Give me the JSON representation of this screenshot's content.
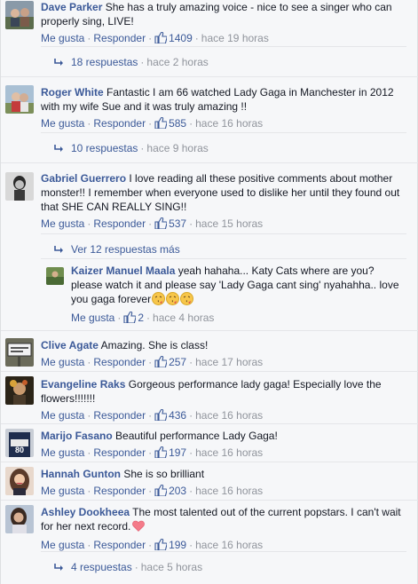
{
  "labels": {
    "like": "Me gusta",
    "reply": "Responder"
  },
  "comments": [
    {
      "author": "Dave Parker",
      "text": "She has a truly amazing voice - nice to see a singer who can properly sing, LIVE!",
      "likes": "1409",
      "time": "hace 19 horas",
      "replies": "18 respuestas",
      "replies_time": "hace 2 horas"
    },
    {
      "author": "Roger White",
      "text": "Fantastic I am 66 watched Lady Gaga in Manchester in 2012 with my wife Sue and it was truly amazing !!",
      "likes": "585",
      "time": "hace 16 horas",
      "replies": "10 respuestas",
      "replies_time": "hace 9 horas"
    },
    {
      "author": "Gabriel Guerrero",
      "text": "I love reading all these positive comments about mother monster!! I remember when everyone used to dislike her until they found out that SHE CAN REALLY SING!!",
      "likes": "537",
      "time": "hace 15 horas",
      "view_more": "Ver 12 respuestas más"
    },
    {
      "author": "Clive Agate",
      "text": "Amazing. She is class!",
      "likes": "257",
      "time": "hace 17 horas"
    },
    {
      "author": "Evangeline Raks",
      "text": "Gorgeous performance lady gaga! Especially love the flowers!!!!!!!",
      "likes": "436",
      "time": "hace 16 horas"
    },
    {
      "author": "Marijo Fasano",
      "text": "Beautiful performance Lady Gaga!",
      "likes": "197",
      "time": "hace 16 horas"
    },
    {
      "author": "Hannah Gunton",
      "text": "She is so brilliant",
      "likes": "203",
      "time": "hace 16 horas"
    },
    {
      "author": "Ashley Dookheea",
      "text": "The most talented out of the current popstars. I can't wait for her next record.",
      "likes": "199",
      "time": "hace 16 horas",
      "replies": "4 respuestas",
      "replies_time": "hace 5 horas"
    }
  ],
  "nested_reply": {
    "author": "Kaizer Manuel Maala",
    "text": "yeah hahaha... Katy Cats where are you? please watch it and please say 'Lady Gaga cant sing' nyahahha.. love you gaga forever",
    "likes": "2",
    "time": "hace 4 horas"
  },
  "colors": {
    "link": "#3b5998",
    "meta": "#90949c",
    "text": "#141823",
    "background": "#f6f7f9"
  },
  "icons": [
    "like-icon",
    "reply-arrow-icon",
    "kissing-face-emoji",
    "heart-icon"
  ]
}
